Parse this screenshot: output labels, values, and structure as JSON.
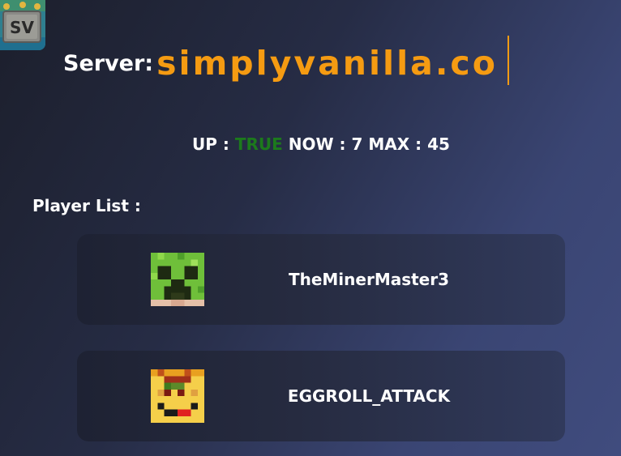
{
  "server_logo": {
    "icon": "server-logo-icon",
    "text": "SV"
  },
  "server": {
    "label": "Server:",
    "value": "simplyvanilla.co",
    "accent_color": "#f59b12"
  },
  "status": {
    "up_label": "UP :",
    "up_value": "TRUE",
    "up_color": "#1c7a1c",
    "now_label": "NOW :",
    "now_value": "7",
    "max_label": "MAX :",
    "max_value": "45"
  },
  "player_list": {
    "label": "Player List :",
    "players": [
      {
        "name": "TheMinerMaster3",
        "avatar": "creeper-face-icon"
      },
      {
        "name": "EGGROLL_ATTACK",
        "avatar": "pixel-face-icon"
      }
    ]
  }
}
